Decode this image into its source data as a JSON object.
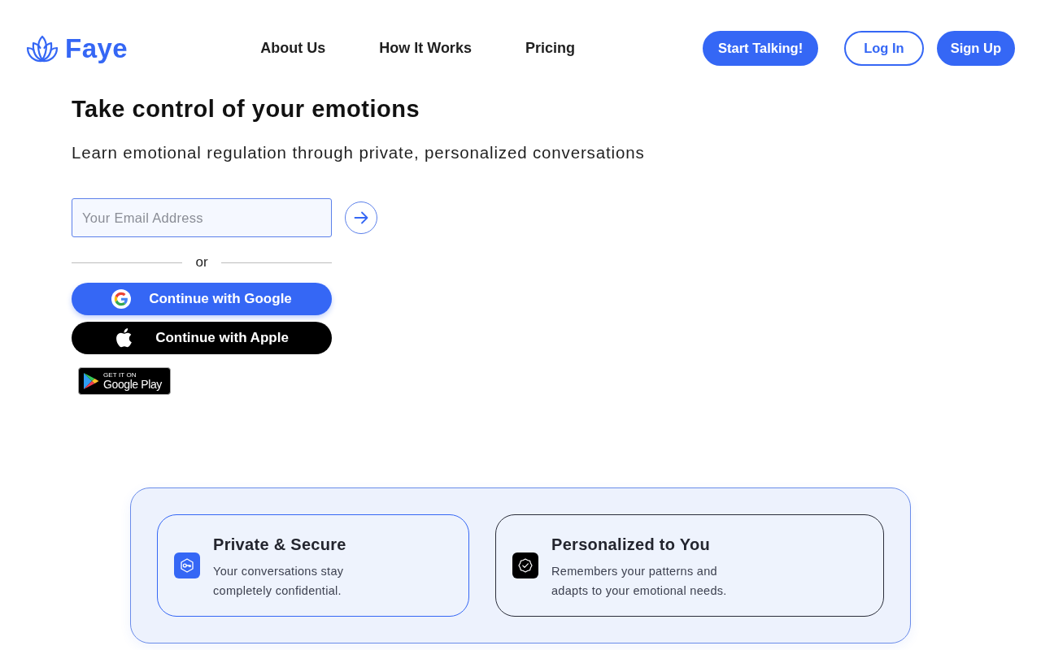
{
  "header": {
    "logo": {
      "text": "Faye"
    },
    "nav": [
      "About Us",
      "How It Works",
      "Pricing"
    ],
    "actions": [
      {
        "label": "Start Talking!",
        "kind": "filled"
      },
      {
        "label": "Log In",
        "kind": "outline"
      },
      {
        "label": "Sign Up",
        "kind": "filled"
      }
    ]
  },
  "hero": {
    "title": "Take control of your emotions",
    "subtitle": "Learn emotional regulation through private, personalized conversations",
    "email": {
      "placeholder": "Your Email Address"
    },
    "divider": "or",
    "auth_buttons": [
      {
        "label": "Continue with Google",
        "kind": "google"
      },
      {
        "label": "Continue with Apple",
        "kind": "apple"
      }
    ],
    "store_badge": {
      "caption": "GET IT ON",
      "store": "Google Play"
    }
  },
  "features": [
    {
      "title": "Private & Secure",
      "description": "Your conversations stay\ncompletely confidential.",
      "color": "#3567f5"
    },
    {
      "title": "Personalized to You",
      "description": "Remembers your patterns and\nadapts to your emotional needs.",
      "color": "#000000"
    }
  ]
}
